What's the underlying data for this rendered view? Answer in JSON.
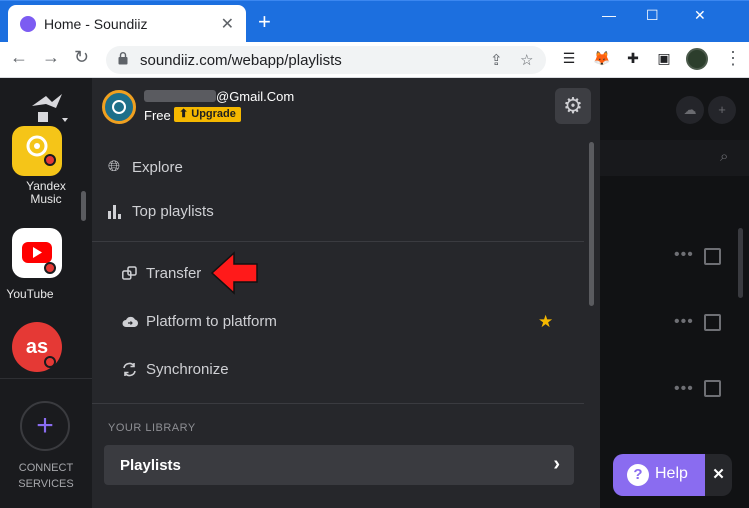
{
  "browser": {
    "tab_title": "Home - Soundiiz",
    "tab_close": "✕",
    "new_tab": "+",
    "url": "soundiiz.com/webapp/playlists",
    "win_minimize": "—",
    "win_maximize": "☐",
    "win_close": "✕",
    "back": "←",
    "forward": "→",
    "reload": "↻",
    "menu": "⋮"
  },
  "rail": {
    "services": [
      {
        "label": "Yandex\nMusic",
        "color": "#f5c518"
      },
      {
        "label": "YouTube",
        "color": "#ff0000"
      },
      {
        "label": "",
        "color": "#e53935"
      }
    ],
    "connect_label_1": "CONNECT",
    "connect_label_2": "SERVICES",
    "connect_plus": "+"
  },
  "account": {
    "email_suffix": "@Gmail.Com",
    "plan": "Free",
    "upgrade": "⬆ Upgrade"
  },
  "menu": {
    "explore": "Explore",
    "top_playlists": "Top playlists",
    "transfer": "Transfer",
    "platform_to_platform": "Platform to platform",
    "synchronize": "Synchronize"
  },
  "library": {
    "heading": "YOUR LIBRARY",
    "playlists": "Playlists",
    "playlists_chevron": "›"
  },
  "help": {
    "label": "Help",
    "icon": "?",
    "close": "✕"
  },
  "colors": {
    "accent": "#8a6cf0",
    "upgrade": "#f5b800",
    "arrow": "#ff1a1a"
  }
}
